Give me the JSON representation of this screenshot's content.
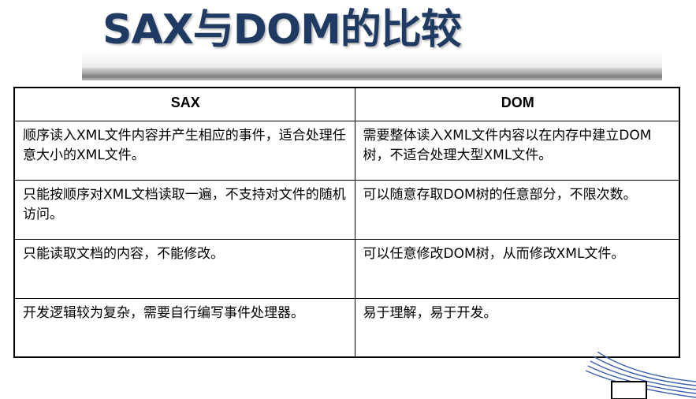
{
  "title": "SAX与DOM的比较",
  "colors": {
    "title": "#1f3a63",
    "decoration": "#3b5fb0"
  },
  "table": {
    "headers": [
      "SAX",
      "DOM"
    ],
    "rows": [
      {
        "sax": "顺序读入XML文件内容并产生相应的事件，适合处理任意大小的XML文件。",
        "dom": "需要整体读入XML文件内容以在内存中建立DOM树，不适合处理大型XML文件。"
      },
      {
        "sax": "只能按顺序对XML文档读取一遍，不支持对文件的随机访问。",
        "dom": "可以随意存取DOM树的任意部分，不限次数。"
      },
      {
        "sax": "只能读取文档的内容，不能修改。",
        "dom": "可以任意修改DOM树，从而修改XML文件。"
      },
      {
        "sax": "开发逻辑较为复杂，需要自行编写事件处理器。",
        "dom": "易于理解，易于开发。"
      }
    ]
  }
}
